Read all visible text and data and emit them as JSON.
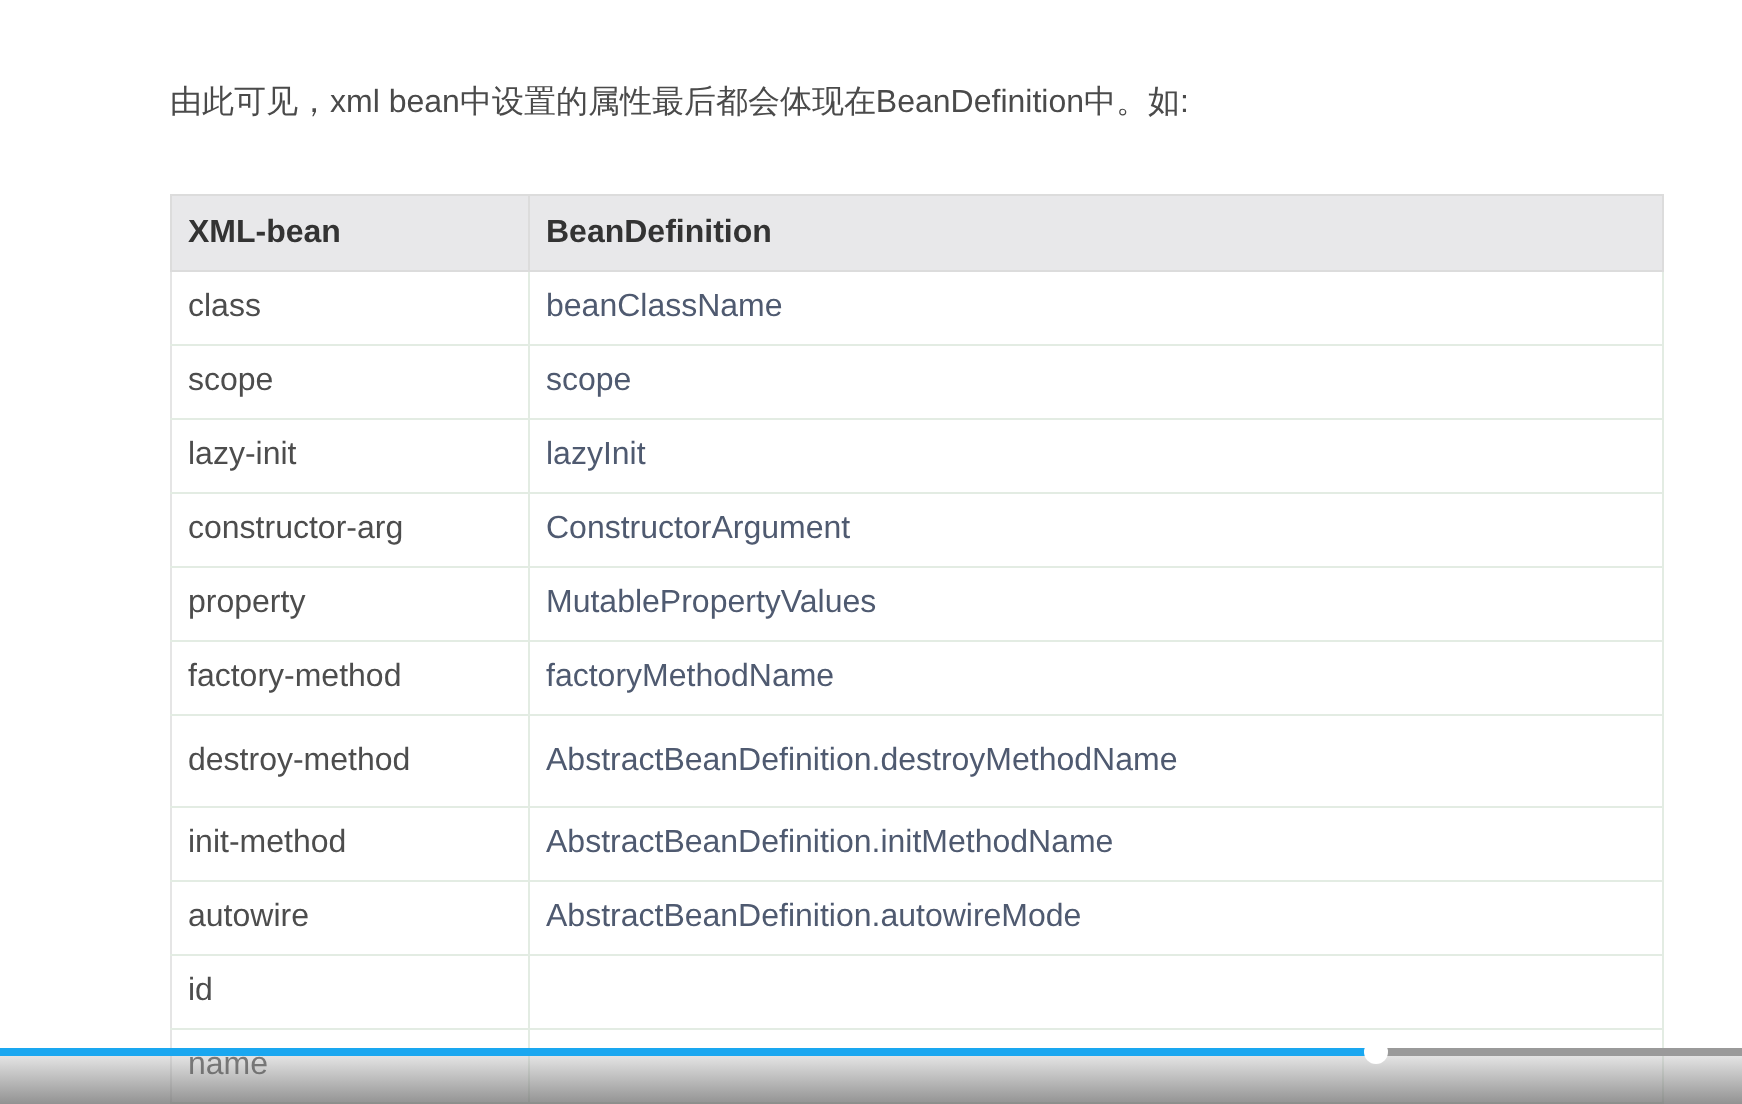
{
  "intro": "由此可见，xml  bean中设置的属性最后都会体现在BeanDefinition中。如:",
  "table": {
    "columns": [
      "XML-bean",
      "BeanDefinition"
    ],
    "rows": [
      [
        "class",
        "beanClassName"
      ],
      [
        "scope",
        "scope"
      ],
      [
        "lazy-init",
        "lazyInit"
      ],
      [
        "constructor-arg",
        "ConstructorArgument"
      ],
      [
        "property",
        "MutablePropertyValues"
      ],
      [
        "factory-method",
        "factoryMethodName"
      ],
      [
        "destroy-method",
        "AbstractBeanDefinition.destroyMethodName"
      ],
      [
        "init-method",
        "AbstractBeanDefinition.initMethodName"
      ],
      [
        "autowire",
        "AbstractBeanDefinition.autowireMode"
      ],
      [
        "id",
        ""
      ],
      [
        "name",
        ""
      ]
    ]
  },
  "player": {
    "progress": {
      "level": 0.79
    }
  }
}
